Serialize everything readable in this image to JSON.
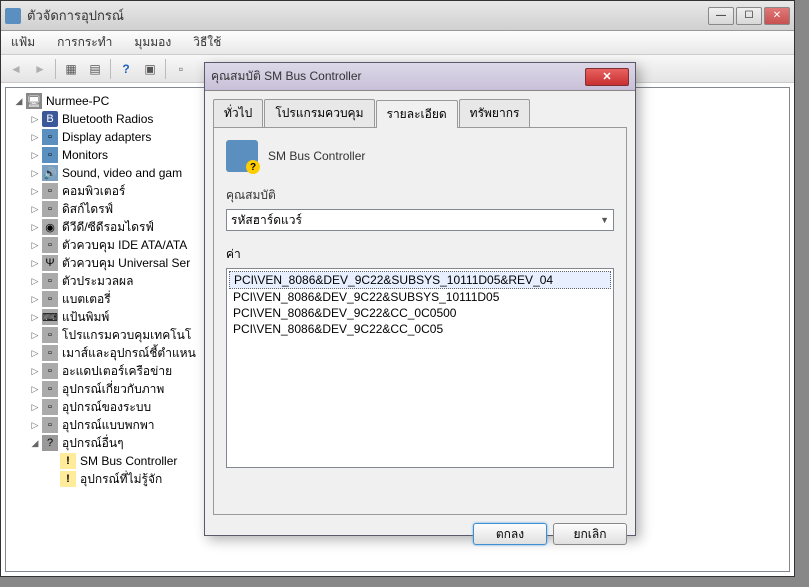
{
  "window": {
    "title": "ตัวจัดการอุปกรณ์",
    "min": "—",
    "max": "☐",
    "close": "✕"
  },
  "menu": {
    "file": "แฟ้ม",
    "action": "การกระทำ",
    "view": "มุมมอง",
    "help": "วิธีใช้"
  },
  "tree": {
    "root": "Nurmee-PC",
    "items": [
      "Bluetooth Radios",
      "Display adapters",
      "Monitors",
      "Sound, video and gam",
      "คอมพิวเตอร์",
      "ดิสก์ไดรฟ์",
      "ดีวีดี/ซีดีรอมไดรฟ์",
      "ตัวควบคุม IDE ATA/ATA",
      "ตัวควบคุม Universal Ser",
      "ตัวประมวลผล",
      "แบตเตอรี่",
      "แป้นพิมพ์",
      "โปรแกรมควบคุมเทคโนโ",
      "เมาส์และอุปกรณ์ชี้ตำแหน",
      "อะแดปเตอร์เครือข่าย",
      "อุปกรณ์เกี่ยวกับภาพ",
      "อุปกรณ์ของระบบ",
      "อุปกรณ์แบบพกพา"
    ],
    "other": "อุปกรณ์อื่นๆ",
    "sub": [
      "SM Bus Controller",
      "อุปกรณ์ที่ไม่รู้จัก"
    ]
  },
  "dialog": {
    "title": "คุณสมบัติ SM Bus Controller",
    "tabs": [
      "ทั่วไป",
      "โปรแกรมควบคุม",
      "รายละเอียด",
      "ทรัพยากร"
    ],
    "device": "SM Bus Controller",
    "propLabel": "คุณสมบัติ",
    "propValue": "รหัสฮาร์ดแวร์",
    "valueLabel": "ค่า",
    "values": [
      "PCI\\VEN_8086&DEV_9C22&SUBSYS_10111D05&REV_04",
      "PCI\\VEN_8086&DEV_9C22&SUBSYS_10111D05",
      "PCI\\VEN_8086&DEV_9C22&CC_0C0500",
      "PCI\\VEN_8086&DEV_9C22&CC_0C05"
    ],
    "ok": "ตกลง",
    "cancel": "ยกเลิก"
  }
}
